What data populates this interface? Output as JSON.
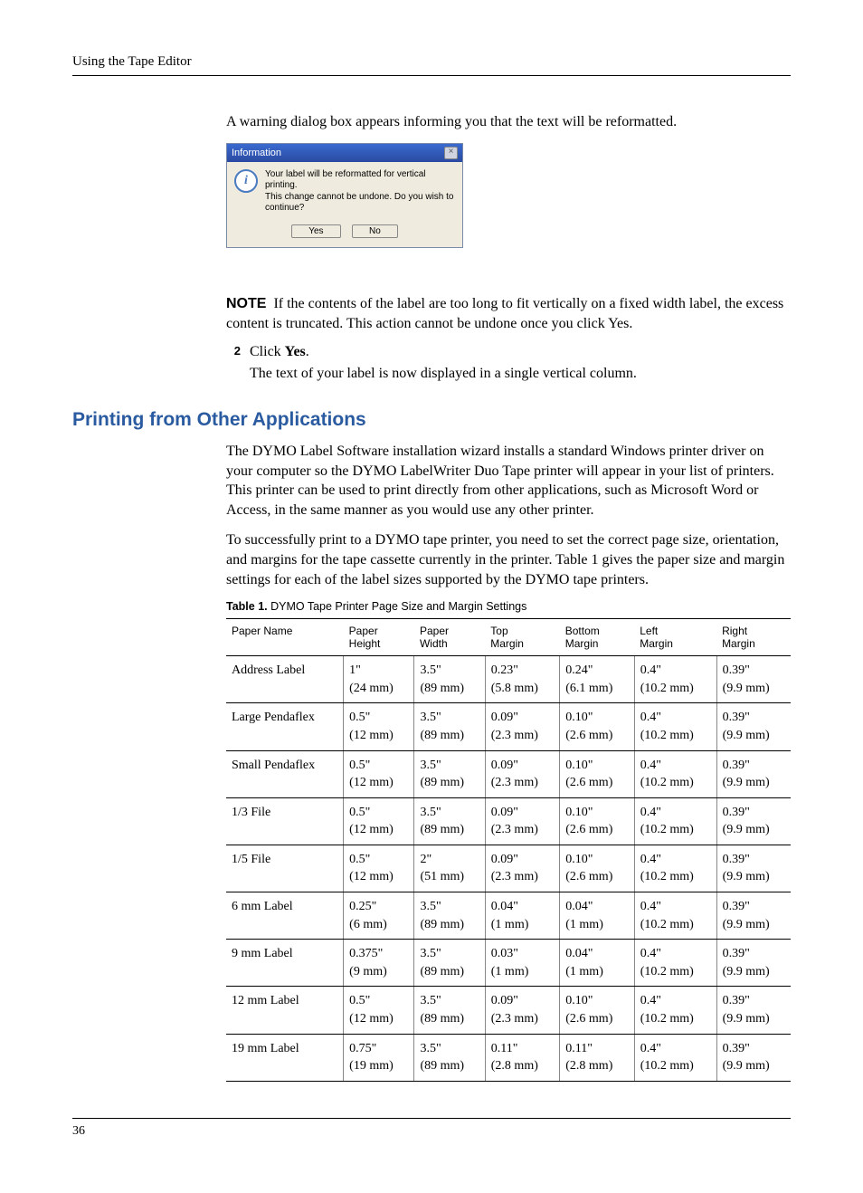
{
  "header": "Using the Tape Editor",
  "intro": "A warning dialog box appears informing you that the text will be reformatted.",
  "dialog": {
    "title": "Information",
    "line1": "Your label will be reformatted for vertical printing.",
    "line2": "This change cannot be undone. Do you wish to continue?",
    "yes": "Yes",
    "no": "No"
  },
  "note": {
    "label": "NOTE",
    "text": "If the contents of the label are too long to fit vertically on a fixed width label, the excess content is truncated. This action cannot be undone once you click Yes."
  },
  "step": {
    "num": "2",
    "action_prefix": "Click ",
    "action_bold": "Yes",
    "action_suffix": ".",
    "result": "The text of your label is now displayed in a single vertical column."
  },
  "section_heading": "Printing from Other Applications",
  "para1": "The DYMO Label Software installation wizard installs a standard Windows printer driver on your computer so the DYMO LabelWriter Duo Tape printer will appear in your list of printers. This printer can be used to print directly from other applications, such as Microsoft Word or Access, in the same manner as you would use any other printer.",
  "para2": "To successfully print to a DYMO tape printer, you need to set the correct page size, orientation, and margins for the tape cassette currently in the printer. Table 1 gives the paper size and margin settings for each of the label sizes supported by the DYMO tape printers.",
  "table_caption": {
    "label": "Table 1.",
    "text": "DYMO Tape Printer Page Size and Margin Settings"
  },
  "columns": [
    {
      "l1": "Paper Name",
      "l2": ""
    },
    {
      "l1": "Paper",
      "l2": "Height"
    },
    {
      "l1": "Paper",
      "l2": "Width"
    },
    {
      "l1": "Top",
      "l2": "Margin"
    },
    {
      "l1": "Bottom",
      "l2": "Margin"
    },
    {
      "l1": "Left",
      "l2": "Margin"
    },
    {
      "l1": "Right",
      "l2": "Margin"
    }
  ],
  "rows": [
    {
      "name": "Address Label",
      "h_in": "1\"",
      "h_mm": "(24 mm)",
      "w_in": "3.5\"",
      "w_mm": "(89 mm)",
      "t_in": "0.23\"",
      "t_mm": "(5.8 mm)",
      "b_in": "0.24\"",
      "b_mm": "(6.1 mm)",
      "l_in": "0.4\"",
      "l_mm": "(10.2 mm)",
      "r_in": "0.39\"",
      "r_mm": "(9.9 mm)"
    },
    {
      "name": "Large Pendaflex",
      "h_in": "0.5\"",
      "h_mm": "(12 mm)",
      "w_in": "3.5\"",
      "w_mm": "(89 mm)",
      "t_in": "0.09\"",
      "t_mm": "(2.3 mm)",
      "b_in": "0.10\"",
      "b_mm": "(2.6 mm)",
      "l_in": "0.4\"",
      "l_mm": "(10.2 mm)",
      "r_in": "0.39\"",
      "r_mm": "(9.9 mm)"
    },
    {
      "name": "Small Pendaflex",
      "h_in": "0.5\"",
      "h_mm": "(12 mm)",
      "w_in": "3.5\"",
      "w_mm": "(89 mm)",
      "t_in": "0.09\"",
      "t_mm": "(2.3 mm)",
      "b_in": "0.10\"",
      "b_mm": "(2.6 mm)",
      "l_in": "0.4\"",
      "l_mm": "(10.2 mm)",
      "r_in": "0.39\"",
      "r_mm": "(9.9 mm)"
    },
    {
      "name": "1/3 File",
      "h_in": "0.5\"",
      "h_mm": "(12 mm)",
      "w_in": "3.5\"",
      "w_mm": "(89 mm)",
      "t_in": "0.09\"",
      "t_mm": "(2.3 mm)",
      "b_in": "0.10\"",
      "b_mm": "(2.6 mm)",
      "l_in": "0.4\"",
      "l_mm": "(10.2 mm)",
      "r_in": "0.39\"",
      "r_mm": "(9.9 mm)"
    },
    {
      "name": "1/5 File",
      "h_in": "0.5\"",
      "h_mm": "(12 mm)",
      "w_in": "2\"",
      "w_mm": "(51 mm)",
      "t_in": "0.09\"",
      "t_mm": "(2.3 mm)",
      "b_in": "0.10\"",
      "b_mm": "(2.6 mm)",
      "l_in": "0.4\"",
      "l_mm": "(10.2 mm)",
      "r_in": "0.39\"",
      "r_mm": "(9.9 mm)"
    },
    {
      "name": "6 mm Label",
      "h_in": "0.25\"",
      "h_mm": "(6 mm)",
      "w_in": "3.5\"",
      "w_mm": "(89 mm)",
      "t_in": "0.04\"",
      "t_mm": "(1 mm)",
      "b_in": "0.04\"",
      "b_mm": "(1 mm)",
      "l_in": "0.4\"",
      "l_mm": "(10.2 mm)",
      "r_in": "0.39\"",
      "r_mm": "(9.9 mm)"
    },
    {
      "name": "9 mm Label",
      "h_in": "0.375\"",
      "h_mm": "(9 mm)",
      "w_in": "3.5\"",
      "w_mm": "(89 mm)",
      "t_in": "0.03\"",
      "t_mm": "(1 mm)",
      "b_in": "0.04\"",
      "b_mm": "(1 mm)",
      "l_in": "0.4\"",
      "l_mm": "(10.2 mm)",
      "r_in": "0.39\"",
      "r_mm": "(9.9 mm)"
    },
    {
      "name": "12 mm Label",
      "h_in": "0.5\"",
      "h_mm": "(12 mm)",
      "w_in": "3.5\"",
      "w_mm": "(89 mm)",
      "t_in": "0.09\"",
      "t_mm": "(2.3 mm)",
      "b_in": "0.10\"",
      "b_mm": "(2.6 mm)",
      "l_in": "0.4\"",
      "l_mm": "(10.2 mm)",
      "r_in": "0.39\"",
      "r_mm": "(9.9 mm)"
    },
    {
      "name": "19 mm Label",
      "h_in": "0.75\"",
      "h_mm": "(19 mm)",
      "w_in": "3.5\"",
      "w_mm": "(89 mm)",
      "t_in": "0.11\"",
      "t_mm": "(2.8 mm)",
      "b_in": "0.11\"",
      "b_mm": "(2.8 mm)",
      "l_in": "0.4\"",
      "l_mm": "(10.2 mm)",
      "r_in": "0.39\"",
      "r_mm": "(9.9 mm)"
    }
  ],
  "page_number": "36"
}
